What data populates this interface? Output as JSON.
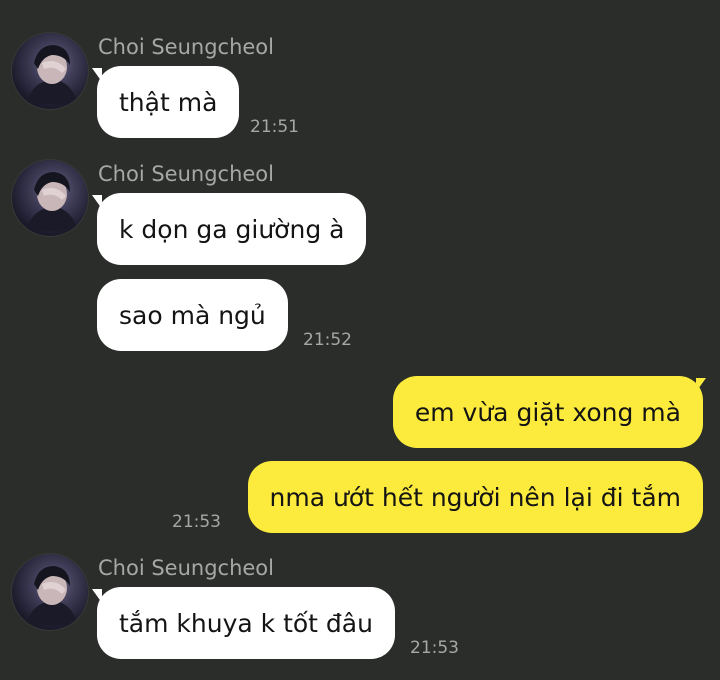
{
  "chat": {
    "groups": [
      {
        "sender": "Choi Seungcheol",
        "avatar_icon": "profile-avatar",
        "messages": [
          {
            "text": "thật mà",
            "time": "21:51"
          }
        ]
      },
      {
        "sender": "Choi Seungcheol",
        "avatar_icon": "profile-avatar",
        "messages": [
          {
            "text": "k dọn ga giường à",
            "time": ""
          },
          {
            "text": "sao mà ngủ",
            "time": "21:52"
          }
        ]
      },
      {
        "sender": "me",
        "messages": [
          {
            "text": "em vừa giặt xong mà",
            "time": ""
          },
          {
            "text": "nma ướt hết người nên lại đi tắm",
            "time": "21:53"
          }
        ]
      },
      {
        "sender": "Choi Seungcheol",
        "avatar_icon": "profile-avatar",
        "messages": [
          {
            "text": "tắm khuya k tốt đâu",
            "time": "21:53"
          }
        ]
      }
    ]
  },
  "colors": {
    "background": "#2b2d2b",
    "incoming_bubble": "#ffffff",
    "outgoing_bubble": "#fceb3c",
    "meta_text": "#a6a8a6"
  }
}
